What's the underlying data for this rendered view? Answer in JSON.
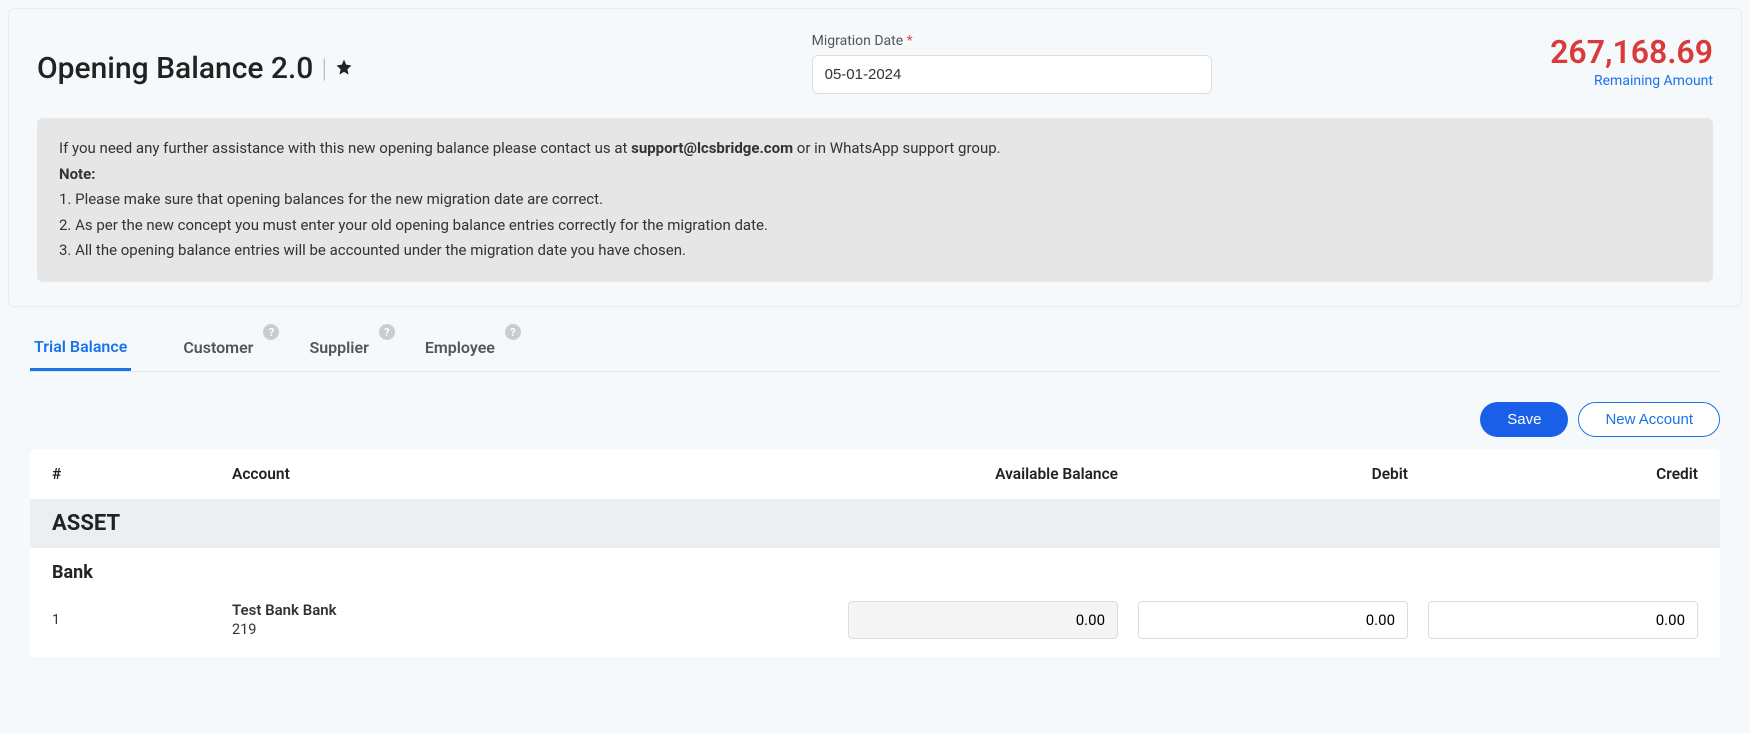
{
  "header": {
    "title": "Opening Balance 2.0",
    "migration_date_label": "Migration Date",
    "migration_date_value": "05-01-2024",
    "remaining_amount_value": "267,168.69",
    "remaining_amount_label": "Remaining Amount"
  },
  "info": {
    "line1_pre": "If you need any further assistance with this new opening balance please contact us at ",
    "line1_email": "support@lcsbridge.com",
    "line1_post": " or in WhatsApp support group.",
    "note_heading": "Note:",
    "note1": "1. Please make sure that opening balances for the new migration date are correct.",
    "note2": "2. As per the new concept you must enter your old opening balance entries correctly for the migration date.",
    "note3": "3. All the opening balance entries will be accounted under the migration date you have chosen."
  },
  "tabs": {
    "trial_balance": "Trial Balance",
    "customer": "Customer",
    "supplier": "Supplier",
    "employee": "Employee"
  },
  "actions": {
    "save": "Save",
    "new_account": "New Account"
  },
  "table": {
    "col_num": "#",
    "col_account": "Account",
    "col_available": "Available Balance",
    "col_debit": "Debit",
    "col_credit": "Credit",
    "group_asset": "ASSET",
    "subgroup_bank": "Bank",
    "row1": {
      "num": "1",
      "account_name": "Test Bank Bank",
      "account_id": "219",
      "available": "0.00",
      "debit": "0.00",
      "credit": "0.00"
    }
  }
}
